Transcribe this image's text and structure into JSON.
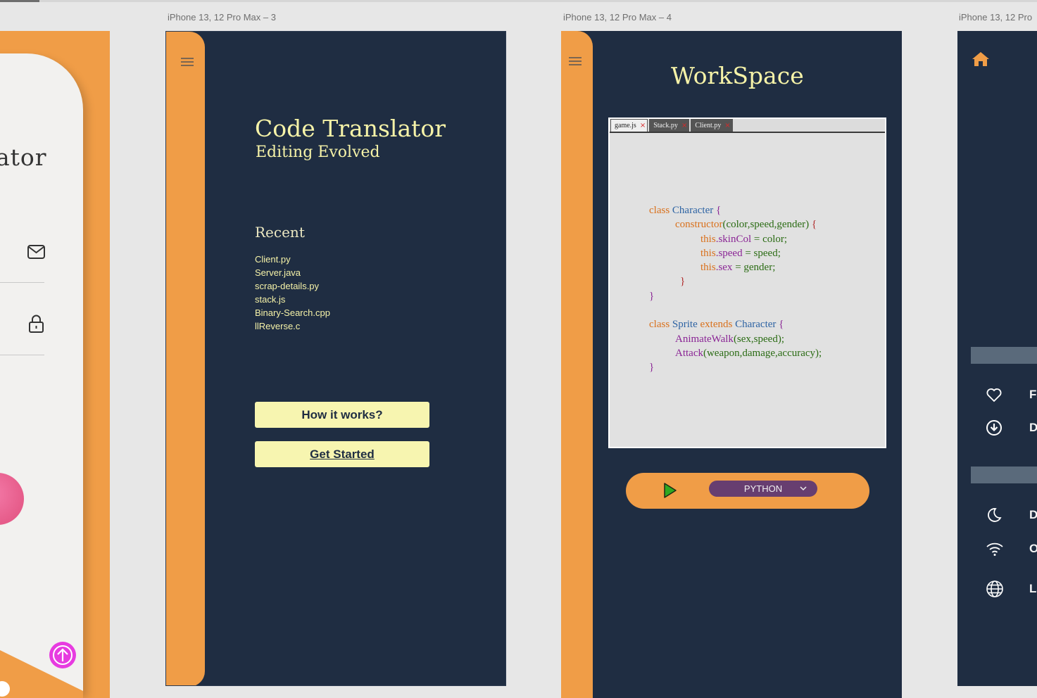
{
  "artboards": {
    "board3_label": "iPhone 13, 12 Pro Max – 3",
    "board4_label": "iPhone 13, 12 Pro Max – 4",
    "board5_label": "iPhone 13, 12 Pro"
  },
  "login_fragment": {
    "title_fragment": "ator"
  },
  "translator": {
    "title": "Code Translator",
    "subtitle": "Editing Evolved",
    "recent_heading": "Recent",
    "recent_files": [
      "Client.py",
      "Server.java",
      "scrap-details.py",
      "stack.js",
      "Binary-Search.cpp",
      "llReverse.c"
    ],
    "how_it_works_label": "How it works?",
    "get_started_label": "Get Started"
  },
  "workspace": {
    "title": "WorkSpace",
    "tabs": [
      {
        "name": "game.js",
        "close": "×"
      },
      {
        "name": "Stack.py",
        "close": "×"
      },
      {
        "name": "Client.py",
        "close": "×"
      }
    ],
    "code_lines": {
      "l1a": "class ",
      "l1b": "Character",
      "l1c": " {",
      "l2a": "constructor",
      "l2b": "(color,speed,gender) ",
      "l2c": "{",
      "l3a": "this",
      "l3b": ".skinCol",
      "l3c": " = color;",
      "l4a": "this",
      "l4b": ".speed",
      "l4c": " = speed;",
      "l5a": "this",
      "l5b": ".sex",
      "l5c": " = gender;",
      "l6": "}",
      "l7": "}",
      "l8a": "class ",
      "l8b": "Sprite ",
      "l8c": "extends ",
      "l8d": "Character",
      "l8e": " {",
      "l9a": "AnimateWalk",
      "l9b": "(sex,speed);",
      "l10a": "Attack",
      "l10b": "(weapon,damage,accuracy);",
      "l11": "}"
    },
    "language": "PYTHON"
  },
  "settings_fragment": {
    "rows": [
      "Fa",
      "D",
      "D",
      "O",
      "La"
    ]
  },
  "colors": {
    "navy": "#1f2d42",
    "orange": "#f09d47",
    "cream": "#f6f3a8",
    "purple": "#673e70",
    "magenta": "#e73be0"
  }
}
